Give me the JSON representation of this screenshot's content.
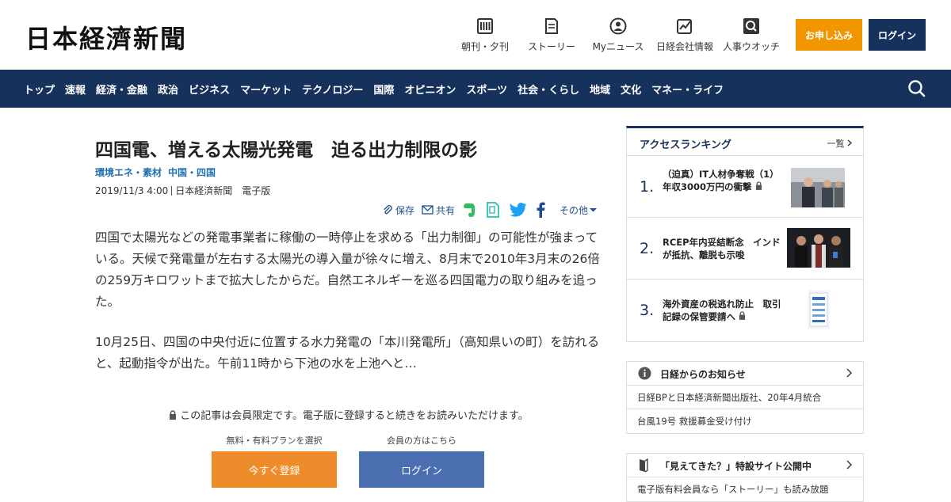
{
  "header": {
    "logo": "日本経濟新聞",
    "nav_icons": [
      {
        "icon": "newspaper-icon",
        "label": "朝刊・夕刊"
      },
      {
        "icon": "story-icon",
        "label": "ストーリー"
      },
      {
        "icon": "user-icon",
        "label": "Myニュース"
      },
      {
        "icon": "company-icon",
        "label": "日経会社情報"
      },
      {
        "icon": "people-search-icon",
        "label": "人事ウオッチ"
      }
    ],
    "apply_label": "お申し込み",
    "login_label": "ログイン"
  },
  "nav": {
    "items": [
      "トップ",
      "速報",
      "経済・金融",
      "政治",
      "ビジネス",
      "マーケット",
      "テクノロジー",
      "国際",
      "オピニオン",
      "スポーツ",
      "社会・くらし",
      "地域",
      "文化",
      "マネー・ライフ"
    ]
  },
  "article": {
    "title": "四国電、増える太陽光発電　迫る出力制限の影",
    "tags": [
      "環境エネ・素材",
      "中国・四国"
    ],
    "date": "2019/11/3 4:00",
    "source": "日本経済新聞　電子版",
    "share": {
      "save": "保存",
      "share": "共有",
      "other": "その他"
    },
    "para1": "四国で太陽光などの発電事業者に稼働の一時停止を求める「出力制御」の可能性が強まっている。天候で発電量が左右する太陽光の導入量が徐々に増え、8月末で2010年3月末の26倍の259万キロワットまで拡大したからだ。自然エネルギーを巡る四国電力の取り組みを追った。",
    "para2": "10月25日、四国の中央付近に位置する水力発電の「本川発電所」（高知県いの町）を訪れると、起動指令が出た。午前11時から下池の水を上池へと…"
  },
  "paywall": {
    "notice": "この記事は会員限定です。電子版に登録すると続きをお読みいただけます。",
    "plan_label": "無料・有料プランを選択",
    "member_label": "会員の方はこちら",
    "register_label": "今すぐ登録",
    "login_label": "ログイン"
  },
  "ranking": {
    "title": "アクセスランキング",
    "more": "一覧",
    "items": [
      {
        "num": "1.",
        "text": "（迫真）IT人材争奪戦（1）　年収3000万円の衝撃"
      },
      {
        "num": "2.",
        "text": "RCEP年内妥結断念　インドが抵抗、離脱も示唆"
      },
      {
        "num": "3.",
        "text": "海外資産の税逃れ防止　取引記録の保管要請へ"
      }
    ]
  },
  "notices": {
    "title": "日経からのお知らせ",
    "items": [
      "日経BPと日本経済新聞出版社、20年4月統合",
      "台風19号 救援募金受け付け"
    ]
  },
  "promo": {
    "title": "「見えてきた？」特設サイト公開中",
    "items": [
      "電子版有料会員なら「ストーリー」も読み放題"
    ]
  }
}
